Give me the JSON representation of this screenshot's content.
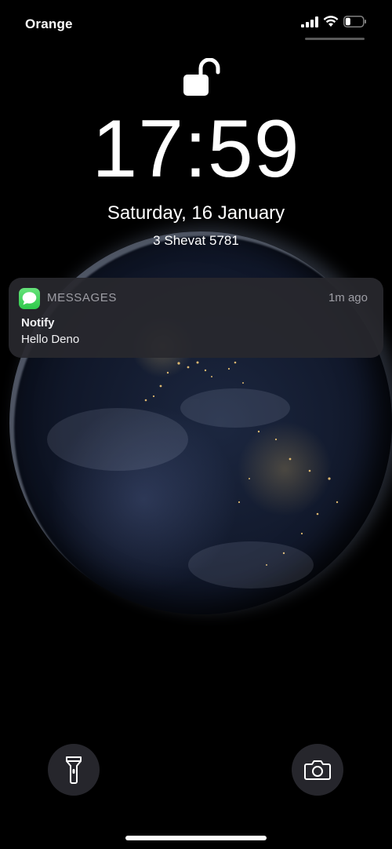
{
  "status_bar": {
    "carrier": "Orange",
    "icons": [
      "cellular-signal-icon",
      "wifi-icon",
      "battery-icon"
    ],
    "battery_level": 0.25
  },
  "lock_screen": {
    "lock_state_icon": "unlocked-padlock-icon",
    "time": "17:59",
    "date": "Saturday, 16 January",
    "secondary_date": "3 Shevat 5781"
  },
  "notification": {
    "app_icon": "messages-icon",
    "app_name": "MESSAGES",
    "time_ago": "1m ago",
    "title": "Notify",
    "body": "Hello Deno"
  },
  "quick_actions": {
    "left": "flashlight-icon",
    "right": "camera-icon"
  },
  "wallpaper": "earth-at-night",
  "colors": {
    "background": "#000000",
    "notification_bg": "#28282e",
    "messages_green": "#34c759",
    "secondary_text": "#9e9ea5"
  }
}
